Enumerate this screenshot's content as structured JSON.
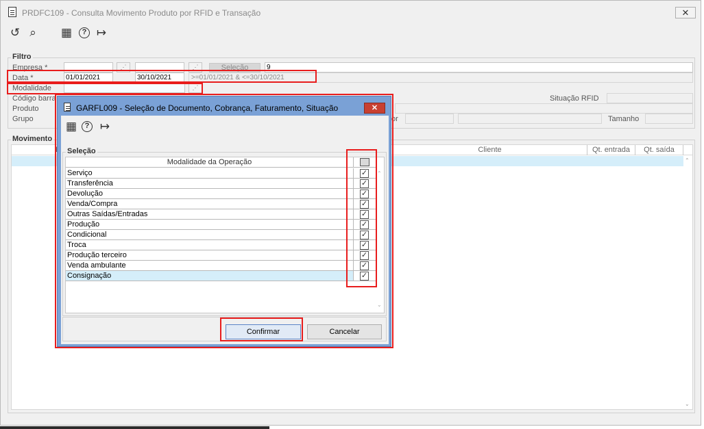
{
  "main_window": {
    "title": "PRDFC109 - Consulta Movimento Produto por RFID e Transação",
    "close_glyph": "✕",
    "toolbar": {
      "icons": [
        "refresh-icon",
        "search-icon",
        "calendar-icon",
        "help-icon",
        "exit-icon"
      ],
      "glyphs": [
        "↺",
        "⌕",
        "▦",
        "?",
        "↦"
      ]
    }
  },
  "filter": {
    "group_label": "Filtro",
    "empresa_label": "Empresa *",
    "data_label": "Data *",
    "modalidade_label": "Modalidade",
    "codigo_barra_label": "Código barra",
    "produto_label": "Produto",
    "grupo_label": "Grupo",
    "selecao_button": "Seleção",
    "empresa_value": "9",
    "data_from": "01/01/2021",
    "data_to": "30/10/2021",
    "data_expression": ">=01/01/2021 & <=30/10/2021",
    "situacao_rfid_label": "Situação RFID",
    "tamanho_label": "Tamanho",
    "partial_label": "or"
  },
  "movimento": {
    "group_label": "Movimento",
    "columns": [
      "Hist",
      "Cliente",
      "Qt. entrada",
      "Qt. saída"
    ]
  },
  "dialog": {
    "title": "GARFL009 - Seleção de Documento, Cobrança, Faturamento, Situação",
    "close_glyph": "✕",
    "toolbar_glyphs": [
      "▦",
      "?",
      "↦"
    ],
    "group_label": "Seleção",
    "column_header": "Modalidade da Operação",
    "check_glyph": "✓",
    "rows": [
      "Serviço",
      "Transferência",
      "Devolução",
      "Venda/Compra",
      "Outras Saídas/Entradas",
      "Produção",
      "Condicional",
      "Troca",
      "Produção terceiro",
      "Venda ambulante",
      "Consignação"
    ],
    "confirm_button": "Confirmar",
    "cancel_button": "Cancelar"
  },
  "colors": {
    "highlight_red": "#e81c1c",
    "dialog_frame": "#7aa1d6",
    "selected_row": "#d5eefa"
  }
}
